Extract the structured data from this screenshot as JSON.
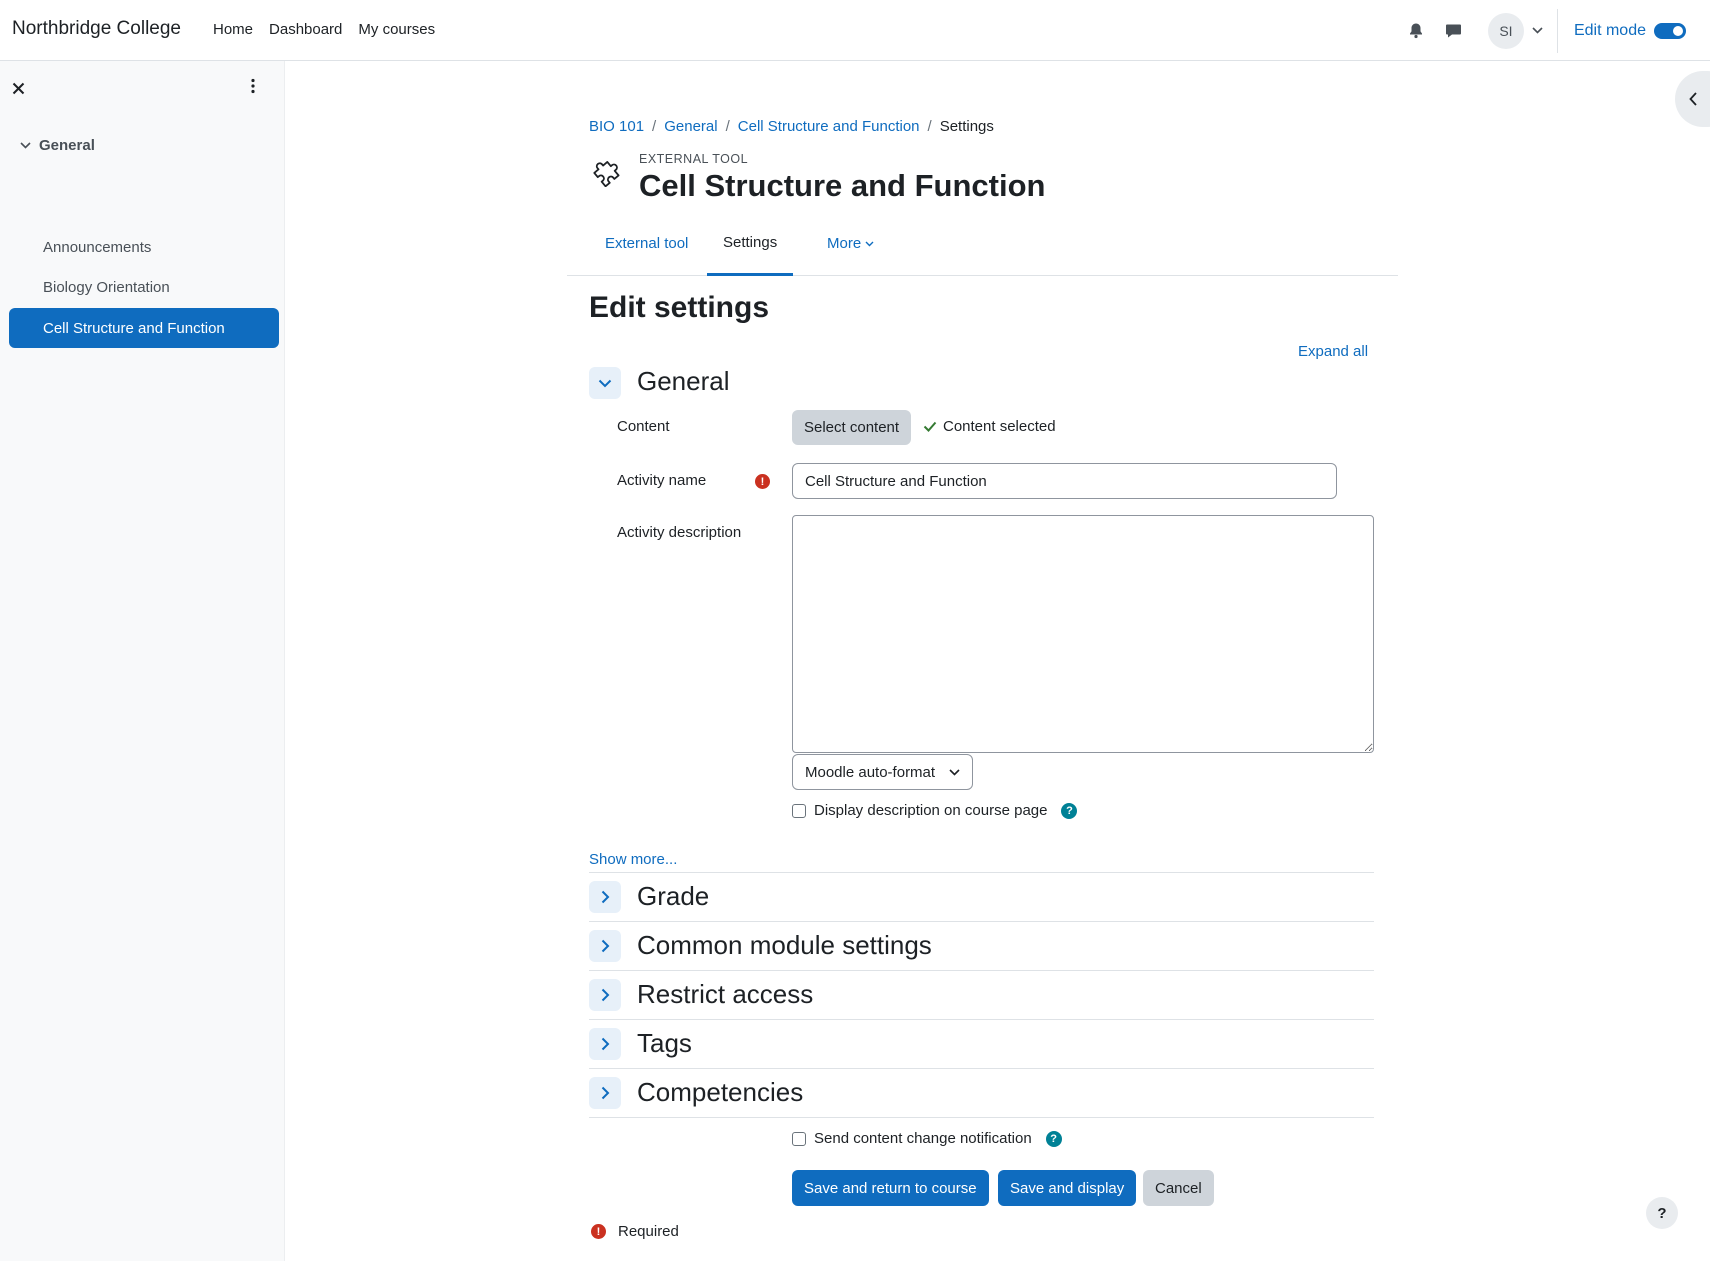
{
  "navbar": {
    "brand": "Northbridge College",
    "links": [
      "Home",
      "Dashboard",
      "My courses"
    ],
    "avatar_initials": "SI",
    "edit_mode_label": "Edit mode"
  },
  "drawer": {
    "section": "General",
    "items": [
      "Announcements",
      "Biology Orientation",
      "Cell Structure and Function"
    ],
    "active_index": 2
  },
  "header": {
    "breadcrumb": [
      "BIO 101",
      "General",
      "Cell Structure and Function",
      "Settings"
    ],
    "pre_title": "EXTERNAL TOOL",
    "title": "Cell Structure and Function",
    "tabs": [
      "External tool",
      "Settings",
      "More"
    ]
  },
  "form": {
    "heading": "Edit settings",
    "expand_all": "Expand all",
    "general_section": "General",
    "content_label": "Content",
    "select_content_button": "Select content",
    "content_selected": "Content selected",
    "activity_name_label": "Activity name",
    "activity_name_value": "Cell Structure and Function",
    "activity_description_label": "Activity description",
    "format_select": "Moodle auto-format",
    "display_description_label": "Display description on course page",
    "show_more": "Show more...",
    "collapsed_sections": [
      "Grade",
      "Common module settings",
      "Restrict access",
      "Tags",
      "Competencies"
    ],
    "send_notification_label": "Send content change notification",
    "buttons": {
      "save_return": "Save and return to course",
      "save_display": "Save and display",
      "cancel": "Cancel"
    },
    "required_label": "Required"
  },
  "colors": {
    "primary": "#0f6cbf",
    "danger": "#ca3120",
    "info": "#008196"
  }
}
